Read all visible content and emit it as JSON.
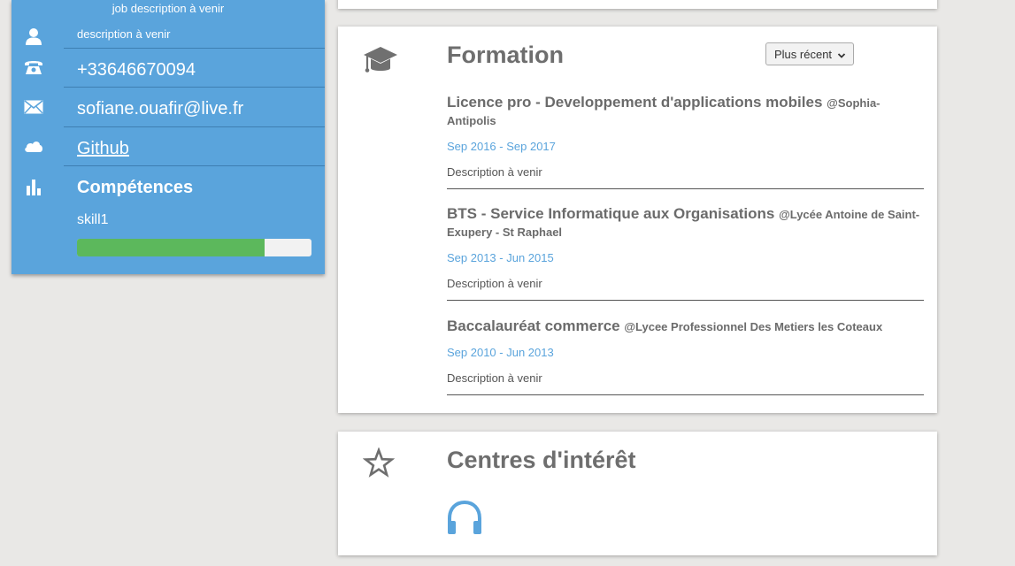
{
  "sidebar": {
    "job_description": "job description à venir",
    "description": "description à venir",
    "phone": "+33646670094",
    "email": "sofiane.ouafir@live.fr",
    "github_label": "Github",
    "skills_title": "Compétences",
    "skills": [
      {
        "name": "skill1",
        "level_percent": 80
      }
    ],
    "icons": [
      "user-icon",
      "phone-icon",
      "mail-icon",
      "cloud-icon",
      "bar-chart-icon"
    ]
  },
  "formation": {
    "title": "Formation",
    "icon": "graduation-cap-icon",
    "sort_selected": "Plus récent",
    "entries": [
      {
        "degree": "Licence pro - Developpement d'applications mobiles",
        "school": "@Sophia-Antipolis",
        "dates": "Sep 2016 - Sep 2017",
        "description": "Description à venir"
      },
      {
        "degree": "BTS - Service Informatique aux Organisations",
        "school": "@Lycée Antoine de Saint-Exupery - St Raphael",
        "dates": "Sep 2013 - Jun 2015",
        "description": "Description à venir"
      },
      {
        "degree": "Baccalauréat commerce",
        "school": "@Lycee Professionnel Des Metiers les Coteaux",
        "dates": "Sep 2010 - Jun 2013",
        "description": "Description à venir"
      }
    ]
  },
  "interests": {
    "title": "Centres d'intérêt",
    "icon": "star-icon",
    "items": [
      "headphones-icon"
    ]
  },
  "colors": {
    "sidebar_bg": "#5aa4dc",
    "accent": "#5aa4dc",
    "skill_fill": "#5cb85c",
    "title_text": "#6e6e6e",
    "page_bg": "#e9e8e6"
  }
}
